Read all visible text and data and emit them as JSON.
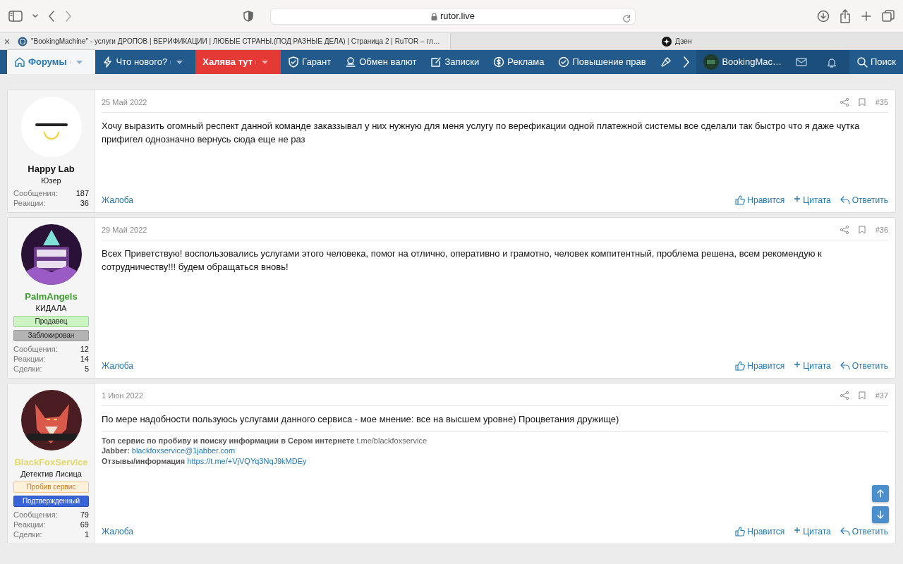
{
  "browser": {
    "url": "rutor.live",
    "tabs": [
      {
        "title": "\"BookingMachine\" - услуги ДРОПОВ | ВЕРИФИКАЦИИ | ЛЮБЫЕ СТРАНЫ.(ПОД РАЗНЫЕ ДЕЛА) | Страница 2 | RuTOR – гл…",
        "selected": true
      },
      {
        "title": "Дзен",
        "selected": false
      }
    ]
  },
  "nav": {
    "items": [
      {
        "label": "Форумы",
        "kind": "link",
        "selected": true,
        "dropdown": true
      },
      {
        "label": "Что нового?",
        "kind": "link",
        "selected": false,
        "dropdown": true
      },
      {
        "label": "Халява тут",
        "kind": "promo",
        "selected": false,
        "dropdown": true
      },
      {
        "label": "Гарант",
        "kind": "link",
        "selected": false,
        "dropdown": false
      },
      {
        "label": "Обмен валют",
        "kind": "link",
        "selected": false,
        "dropdown": false
      },
      {
        "label": "Записки",
        "kind": "link",
        "selected": false,
        "dropdown": false
      },
      {
        "label": "Реклама",
        "kind": "link",
        "selected": false,
        "dropdown": false
      },
      {
        "label": "Повышение прав",
        "kind": "link",
        "selected": false,
        "dropdown": false
      },
      {
        "kind": "tool",
        "selected": false,
        "dropdown": false
      }
    ],
    "user": "BookingMac…",
    "search": "Поиск"
  },
  "posts": [
    {
      "date": "25 Май 2022",
      "number": "#35",
      "author": {
        "name": "Happy Lab",
        "color": "#141414",
        "title": "Юзер",
        "stats": [
          {
            "label": "Сообщения:",
            "value": "187"
          },
          {
            "label": "Реакции:",
            "value": "36"
          }
        ]
      },
      "body": "Хочу выразить огомный респект данной команде заказзывал у них нужную для меня услугу по верефикации одной платежной системы все сделали так быстро что я даже чутка прифигел однозначно вернусь сюда еще не раз",
      "report": "Жалоба",
      "actions": [
        "Нравится",
        "Цитата",
        "Ответить"
      ]
    },
    {
      "date": "29 Май 2022",
      "number": "#36",
      "author": {
        "name": "PalmAngels",
        "color": "#3c9a2c",
        "title": "КИДАЛА",
        "banners": [
          {
            "label": "Продавец",
            "kind": "seller"
          },
          {
            "label": "Заблокирован",
            "kind": "blocked"
          }
        ],
        "stats": [
          {
            "label": "Сообщения:",
            "value": "12"
          },
          {
            "label": "Реакции:",
            "value": "14"
          },
          {
            "label": "Сделки:",
            "value": "5"
          }
        ]
      },
      "body": "Всех Приветствую! воспользовались услугами этого человека, помог на отлично, оперативно и грамотно, человек компитентный, проблема решена, всем рекомендую к сотрудничеству!!! будем обращаться вновь!",
      "report": "Жалоба",
      "actions": [
        "Нравится",
        "Цитата",
        "Ответить"
      ]
    },
    {
      "date": "1 Июн 2022",
      "number": "#37",
      "author": {
        "name": "BlackFoxService",
        "color": "#e2d86a",
        "title": "Детектив Лисица",
        "banners": [
          {
            "label": "Пробив сервис",
            "kind": "service"
          },
          {
            "label": "Подтвержденный",
            "kind": "verified"
          }
        ],
        "stats": [
          {
            "label": "Сообщения:",
            "value": "79"
          },
          {
            "label": "Реакции:",
            "value": "69"
          },
          {
            "label": "Сделки:",
            "value": "1"
          }
        ]
      },
      "body": "По мере надобности пользуюсь услугами данного сервиса - мое мнение: все на высшем уровне) Процветания дружище)",
      "signature": [
        {
          "label": "Топ сервис по пробиву и поиску информации в Сером интернете",
          "value": "t.me/blackfoxservice",
          "kind": "text"
        },
        {
          "label": "Jabber:",
          "value": "blackfoxservice@1jabber.com",
          "kind": "link"
        },
        {
          "label": "Отзывы/информация",
          "value": "https://t.me/+VjVQYq3NqJ9kMDEy",
          "kind": "link"
        }
      ],
      "report": "Жалоба",
      "actions": [
        "Нравится",
        "Цитата",
        "Ответить"
      ]
    }
  ]
}
